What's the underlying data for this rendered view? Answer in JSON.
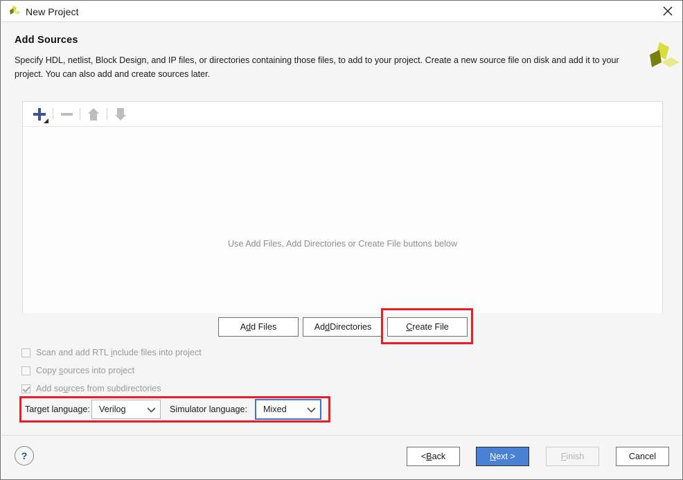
{
  "window": {
    "title": "New Project",
    "icon": "xilinx-logo-icon",
    "close_icon": "close-icon"
  },
  "header": {
    "title": "Add Sources",
    "description": "Specify HDL, netlist, Block Design, and IP files, or directories containing those files, to add to your project. Create a new source file on disk and add it to your project. You can also add and create sources later.",
    "logo": "xilinx-logo"
  },
  "toolbar": {
    "add_icon": "plus-icon",
    "add_dropdown_icon": "dropdown-triangle-icon",
    "remove_icon": "minus-icon",
    "move_up_icon": "arrow-up-icon",
    "move_down_icon": "arrow-down-icon"
  },
  "sources_panel": {
    "empty_message": "Use Add Files, Add Directories or Create File buttons below"
  },
  "actions": {
    "add_files": {
      "pre": "A",
      "mnemonic": "d",
      "post": "d Files"
    },
    "add_directories": {
      "pre": "Ad",
      "mnemonic": "d",
      "post": " Directories"
    },
    "create_file": {
      "pre": "",
      "mnemonic": "C",
      "post": "reate File"
    }
  },
  "options": [
    {
      "label_pre": "Scan and add RTL ",
      "mnemonic": "i",
      "label_post": "nclude files into project",
      "checked": false,
      "enabled": false
    },
    {
      "label_pre": "Copy ",
      "mnemonic": "s",
      "label_post": "ources into project",
      "checked": false,
      "enabled": false
    },
    {
      "label_pre": "Add so",
      "mnemonic": "u",
      "label_post": "rces from subdirectories",
      "checked": true,
      "enabled": false
    }
  ],
  "languages": {
    "target_label": "Target language:",
    "target_value": "Verilog",
    "simulator_label": "Simulator language:",
    "simulator_value": "Mixed",
    "dropdown_icon": "chevron-down-icon"
  },
  "footer": {
    "help_label": "?",
    "back": {
      "pre": "< ",
      "mnemonic": "B",
      "post": "ack"
    },
    "next": {
      "pre": "",
      "mnemonic": "N",
      "post": "ext >"
    },
    "finish": {
      "pre": "",
      "mnemonic": "F",
      "post": "inish"
    },
    "cancel": {
      "pre": "Cancel",
      "mnemonic": "",
      "post": ""
    }
  },
  "highlights": {
    "color": "#ee1c25",
    "regions": [
      "create-file-button",
      "language-row"
    ]
  },
  "colors": {
    "accent_blue": "#4a81d4",
    "focus_blue": "#3a74c4",
    "plus_blue": "#3a5496",
    "highlight_red": "#ee1c25",
    "disabled_gray": "#9a9a9a"
  }
}
